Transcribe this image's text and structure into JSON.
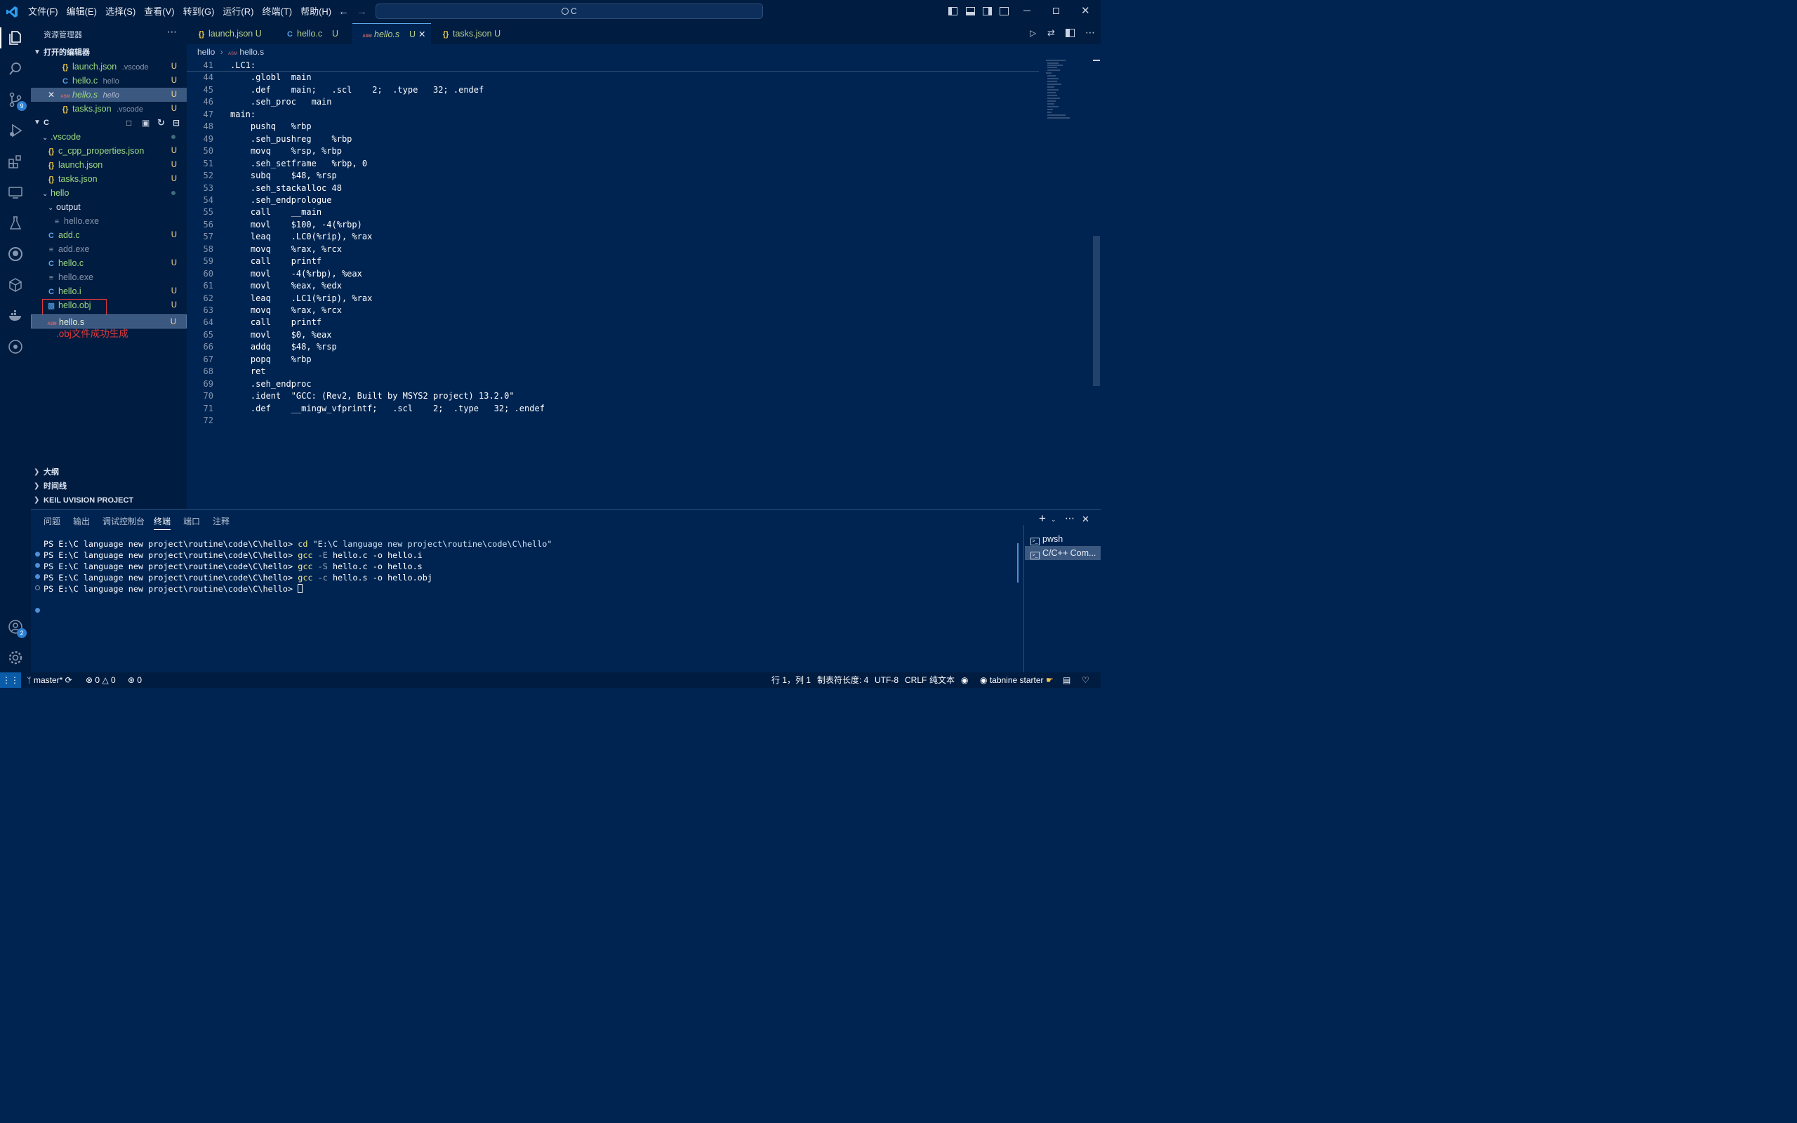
{
  "menu": [
    "文件(F)",
    "编辑(E)",
    "选择(S)",
    "查看(V)",
    "转到(G)",
    "运行(R)",
    "终端(T)",
    "帮助(H)"
  ],
  "search": {
    "text": "C"
  },
  "activity": {
    "scm_badge": "9",
    "accounts_badge": "2"
  },
  "explorer": {
    "title": "资源管理器",
    "open_editors": {
      "title": "打开的编辑器",
      "items": [
        {
          "name": "launch.json",
          "dir": ".vscode",
          "status": "U"
        },
        {
          "name": "hello.c",
          "dir": "hello",
          "status": "U"
        },
        {
          "name": "hello.s",
          "dir": "hello",
          "status": "U"
        },
        {
          "name": "tasks.json",
          "dir": ".vscode",
          "status": "U"
        }
      ]
    },
    "folder": {
      "name": "C",
      "tree": [
        {
          "name": ".vscode",
          "status": ""
        },
        {
          "name": "c_cpp_properties.json",
          "status": "U"
        },
        {
          "name": "launch.json",
          "status": "U"
        },
        {
          "name": "tasks.json",
          "status": "U"
        },
        {
          "name": "hello",
          "status": ""
        },
        {
          "name": "output",
          "status": ""
        },
        {
          "name": "hello.exe",
          "status": ""
        },
        {
          "name": "add.c",
          "status": "U"
        },
        {
          "name": "add.exe",
          "status": ""
        },
        {
          "name": "hello.c",
          "status": "U"
        },
        {
          "name": "hello.exe",
          "status": ""
        },
        {
          "name": "hello.i",
          "status": "U"
        },
        {
          "name": "hello.obj",
          "status": "U"
        },
        {
          "name": "hello.s",
          "status": "U"
        }
      ]
    },
    "annotation": ".obj文件成功生成",
    "outline": "大纲",
    "timeline": "时间线",
    "keil": "KEIL UVISION PROJECT"
  },
  "tabs": [
    {
      "name": "launch.json",
      "status": "U"
    },
    {
      "name": "hello.c",
      "status": "U"
    },
    {
      "name": "hello.s",
      "status": "U"
    },
    {
      "name": "tasks.json",
      "status": "U"
    }
  ],
  "breadcrumb": {
    "folder": "hello",
    "file": "hello.s"
  },
  "code": [
    {
      "n": "41",
      "t": ".LC1:"
    },
    {
      "n": "44",
      "t": "    .globl  main"
    },
    {
      "n": "45",
      "t": "    .def    main;   .scl    2;  .type   32; .endef"
    },
    {
      "n": "46",
      "t": "    .seh_proc   main"
    },
    {
      "n": "47",
      "t": "main:"
    },
    {
      "n": "48",
      "t": "    pushq   %rbp"
    },
    {
      "n": "49",
      "t": "    .seh_pushreg    %rbp"
    },
    {
      "n": "50",
      "t": "    movq    %rsp, %rbp"
    },
    {
      "n": "51",
      "t": "    .seh_setframe   %rbp, 0"
    },
    {
      "n": "52",
      "t": "    subq    $48, %rsp"
    },
    {
      "n": "53",
      "t": "    .seh_stackalloc 48"
    },
    {
      "n": "54",
      "t": "    .seh_endprologue"
    },
    {
      "n": "55",
      "t": "    call    __main"
    },
    {
      "n": "56",
      "t": "    movl    $100, -4(%rbp)"
    },
    {
      "n": "57",
      "t": "    leaq    .LC0(%rip), %rax"
    },
    {
      "n": "58",
      "t": "    movq    %rax, %rcx"
    },
    {
      "n": "59",
      "t": "    call    printf"
    },
    {
      "n": "60",
      "t": "    movl    -4(%rbp), %eax"
    },
    {
      "n": "61",
      "t": "    movl    %eax, %edx"
    },
    {
      "n": "62",
      "t": "    leaq    .LC1(%rip), %rax"
    },
    {
      "n": "63",
      "t": "    movq    %rax, %rcx"
    },
    {
      "n": "64",
      "t": "    call    printf"
    },
    {
      "n": "65",
      "t": "    movl    $0, %eax"
    },
    {
      "n": "66",
      "t": "    addq    $48, %rsp"
    },
    {
      "n": "67",
      "t": "    popq    %rbp"
    },
    {
      "n": "68",
      "t": "    ret"
    },
    {
      "n": "69",
      "t": "    .seh_endproc"
    },
    {
      "n": "70",
      "t": "    .ident  \"GCC: (Rev2, Built by MSYS2 project) 13.2.0\""
    },
    {
      "n": "71",
      "t": "    .def    __mingw_vfprintf;   .scl    2;  .type   32; .endef"
    },
    {
      "n": "72",
      "t": ""
    }
  ],
  "panel": {
    "tabs": [
      "问题",
      "输出",
      "调试控制台",
      "终端",
      "端口",
      "注释"
    ],
    "terminal": [
      {
        "prompt": "PS E:\\C language new project\\routine\\code\\C\\hello> ",
        "cmd": "cd",
        "args": " \"E:\\C language new project\\routine\\code\\C\\hello\""
      },
      {
        "prompt": "PS E:\\C language new project\\routine\\code\\C\\hello> ",
        "cmd": "gcc",
        "flag": " -E",
        "args": " hello.c -o hello.i"
      },
      {
        "prompt": "PS E:\\C language new project\\routine\\code\\C\\hello> ",
        "cmd": "gcc",
        "flag": " -S",
        "args": " hello.c -o hello.s"
      },
      {
        "prompt": "PS E:\\C language new project\\routine\\code\\C\\hello> ",
        "cmd": "gcc",
        "flag": " -c",
        "args": " hello.s -o hello.obj"
      },
      {
        "prompt": "PS E:\\C language new project\\routine\\code\\C\\hello> ",
        "cmd": "",
        "args": ""
      }
    ],
    "shells": [
      "pwsh",
      "C/C++ Com..."
    ]
  },
  "status": {
    "branch": "master*",
    "errors": "0",
    "warnings": "0",
    "ports": "0",
    "position": "行 1，列 1",
    "indent": "制表符长度: 4",
    "encoding": "UTF-8",
    "eol": "CRLF",
    "language": "纯文本",
    "tabnine": "tabnine starter"
  }
}
